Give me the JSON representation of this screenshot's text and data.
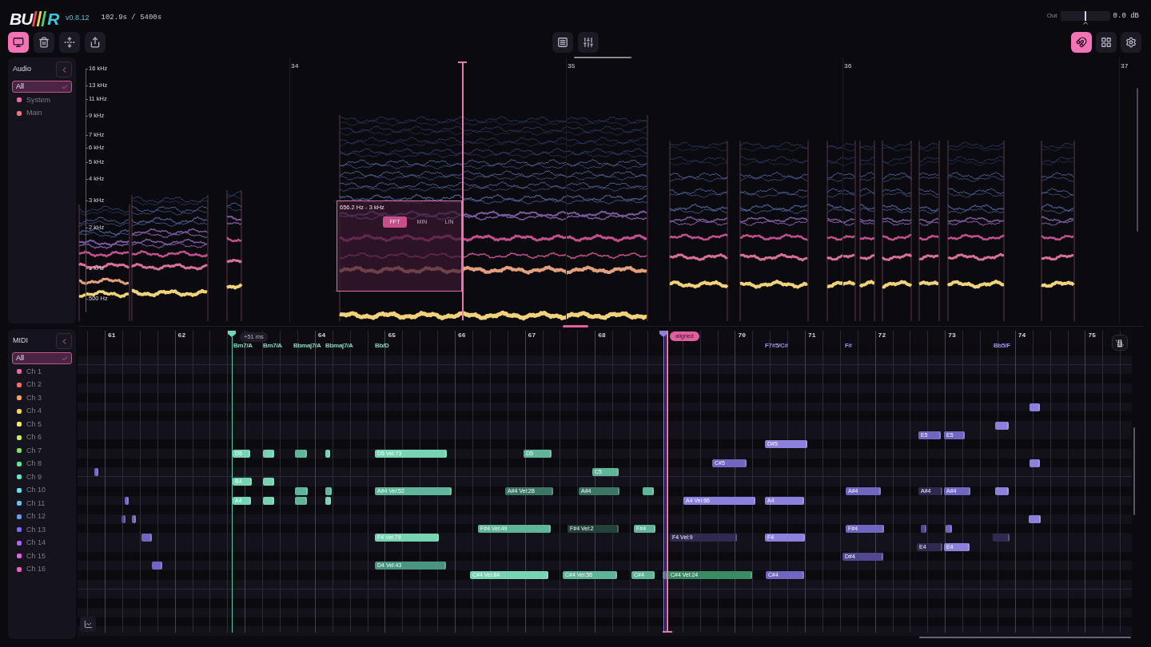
{
  "app": {
    "logo": {
      "lead": "BU",
      "end": "R"
    },
    "version": "v0.8.12",
    "time": "102.9s / 5400s"
  },
  "output": {
    "label": "Out",
    "level": 0.5,
    "reading": "0.0 dB"
  },
  "toolbar": {
    "left": [
      {
        "kind": "monitor",
        "selected": true
      },
      {
        "kind": "trash",
        "selected": false
      },
      {
        "kind": "expand",
        "selected": false
      },
      {
        "kind": "export",
        "selected": false
      }
    ],
    "center": [
      {
        "kind": "list"
      },
      {
        "kind": "mixer"
      }
    ],
    "right": [
      {
        "kind": "magnet",
        "selected": true
      },
      {
        "kind": "grid",
        "selected": false
      },
      {
        "kind": "settings",
        "selected": false
      }
    ]
  },
  "audio": {
    "title": "Audio",
    "items": [
      {
        "label": "All",
        "selected": true
      },
      {
        "label": "System",
        "selected": false,
        "color": "#f06aa8"
      },
      {
        "label": "Main",
        "selected": false,
        "color": "#f07a7a"
      }
    ]
  },
  "spectrogram": {
    "bar_numbers": [
      "34",
      "35",
      "36",
      "37"
    ],
    "frequency_labels": [
      "16 kHz",
      "13 kHz",
      "11 kHz",
      "9 kHz",
      "7 kHz",
      "6 kHz",
      "5 kHz",
      "4 kHz",
      "3 kHz",
      "2 kHz",
      "1 kHz",
      "500 Hz"
    ],
    "selection": {
      "range": "656.2 Hz - 3 kHz",
      "modes": [
        {
          "label": "FFT",
          "selected": true
        },
        {
          "label": "MIN",
          "selected": false
        },
        {
          "label": "LIN",
          "selected": false
        }
      ]
    }
  },
  "midi": {
    "title": "MIDI",
    "channels": [
      {
        "label": "All",
        "selected": true
      },
      {
        "label": "Ch 1",
        "selected": false,
        "color": "#f068a6"
      },
      {
        "label": "Ch 2",
        "selected": false,
        "color": "#f2705c"
      },
      {
        "label": "Ch 3",
        "selected": false,
        "color": "#f5a45e"
      },
      {
        "label": "Ch 4",
        "selected": false,
        "color": "#f4d45e"
      },
      {
        "label": "Ch 5",
        "selected": false,
        "color": "#eef262"
      },
      {
        "label": "Ch 6",
        "selected": false,
        "color": "#c2f05e"
      },
      {
        "label": "Ch 7",
        "selected": false,
        "color": "#82e260"
      },
      {
        "label": "Ch 8",
        "selected": false,
        "color": "#62e894"
      },
      {
        "label": "Ch 9",
        "selected": false,
        "color": "#62e8c8"
      },
      {
        "label": "Ch 10",
        "selected": false,
        "color": "#62e4f2"
      },
      {
        "label": "Ch 11",
        "selected": false,
        "color": "#62c6f2"
      },
      {
        "label": "Ch 12",
        "selected": false,
        "color": "#6a9af2"
      },
      {
        "label": "Ch 13",
        "selected": false,
        "color": "#7e6cf0"
      },
      {
        "label": "Ch 14",
        "selected": false,
        "color": "#b262f0"
      },
      {
        "label": "Ch 15",
        "selected": false,
        "color": "#e262f0"
      },
      {
        "label": "Ch 16",
        "selected": false,
        "color": "#f062c6"
      }
    ]
  },
  "piano_roll": {
    "bar_numbers": [
      "61",
      "62",
      "64",
      "65",
      "66",
      "67",
      "68",
      "70",
      "71",
      "72",
      "73",
      "74",
      "75"
    ],
    "chords": [
      {
        "label": "Bm7/A",
        "color": "#7fd6b8"
      },
      {
        "label": "Bm7/A",
        "color": "#7fd6b8"
      },
      {
        "label": "Bbmaj7/A",
        "color": "#7fd6b8"
      },
      {
        "label": "Bbmaj7/A",
        "color": "#7fd6b8"
      },
      {
        "label": "Bb/D",
        "color": "#7fd6b8"
      },
      {
        "label": "F7#5/C#",
        "color": "#9d92e6"
      },
      {
        "label": "F#",
        "color": "#9d92e6"
      },
      {
        "label": "Bb5/F",
        "color": "#9d92e6"
      }
    ],
    "markers": [
      {
        "kind": "offset",
        "label": "+51 ms"
      },
      {
        "kind": "alignment",
        "label": "aligned"
      }
    ],
    "notes": [
      {
        "color": "#8b80dc"
      },
      {
        "color": "#8b80dc"
      },
      {
        "label": "E5",
        "color": "#7065c0"
      },
      {
        "label": "E5",
        "color": "#7065c0"
      },
      {
        "label": "D#5",
        "color": "#8b80dc"
      },
      {
        "label": "D5",
        "color": "#78d3b3"
      },
      {
        "color": "#78d3b3"
      },
      {
        "color": "#60b497"
      },
      {
        "color": "#78d3b3"
      },
      {
        "label": "D5 Vel:73",
        "color": "#78d3b3"
      },
      {
        "label": "D5",
        "color": "#60b497"
      },
      {
        "label": "C#5",
        "color": "#7065c0"
      },
      {
        "color": "#8b80dc"
      },
      {
        "color": "#7065c0"
      },
      {
        "label": "C5",
        "color": "#60b497"
      },
      {
        "label": "B4",
        "color": "#78d3b3"
      },
      {
        "color": "#78d3b3"
      },
      {
        "color": "#60b497"
      },
      {
        "color": "#60b497"
      },
      {
        "label": "A#4 Vel:52",
        "color": "#60b497"
      },
      {
        "label": "A#4 Vel:28",
        "color": "#3d7564"
      },
      {
        "label": "A#4",
        "color": "#3d7564"
      },
      {
        "color": "#60b497"
      },
      {
        "label": "A#4",
        "color": "#7065c0"
      },
      {
        "label": "A#4",
        "color": "#2f2a50"
      },
      {
        "label": "A#4",
        "color": "#7065c0"
      },
      {
        "color": "#8b80dc"
      },
      {
        "color": "#7065c0"
      },
      {
        "label": "A4",
        "color": "#78d3b3"
      },
      {
        "color": "#78d3b3"
      },
      {
        "color": "#60b497"
      },
      {
        "color": "#78d3b3"
      },
      {
        "label": "A4 Vel:66",
        "color": "#8b80dc"
      },
      {
        "label": "A4",
        "color": "#8b80dc"
      },
      {
        "color": "#51488f"
      },
      {
        "color": "#7065c0"
      },
      {
        "color": "#8b80dc"
      },
      {
        "label": "F#4 Vel:49",
        "color": "#60b497"
      },
      {
        "label": "F#4 Vel:2",
        "color": "#25423a"
      },
      {
        "label": "F#4",
        "color": "#60b497"
      },
      {
        "label": "F#4",
        "color": "#7065c0"
      },
      {
        "color": "#51488f"
      },
      {
        "color": "#7065c0"
      },
      {
        "color": "#7065c0"
      },
      {
        "label": "F4 Vel:79",
        "color": "#78d3b3"
      },
      {
        "label": "F4 Vel:9",
        "color": "#2f2a50"
      },
      {
        "label": "F4",
        "color": "#8b80dc"
      },
      {
        "color": "#2f2a50"
      },
      {
        "label": "E4",
        "color": "#2f2a50"
      },
      {
        "label": "E4",
        "color": "#8b80dc"
      },
      {
        "label": "D#4",
        "color": "#51488f"
      },
      {
        "color": "#7065c0"
      },
      {
        "label": "D4 Vel:43",
        "color": "#4a9580"
      },
      {
        "label": "C#4 Vel:84",
        "color": "#78d3b3"
      },
      {
        "label": "C#4 Vel:56",
        "color": "#60b497"
      },
      {
        "label": "C#4",
        "color": "#60b497"
      },
      {
        "label": "C#4 Vel:24",
        "color": "#3b8a66"
      },
      {
        "label": "C#4",
        "color": "#7065c0"
      }
    ]
  }
}
